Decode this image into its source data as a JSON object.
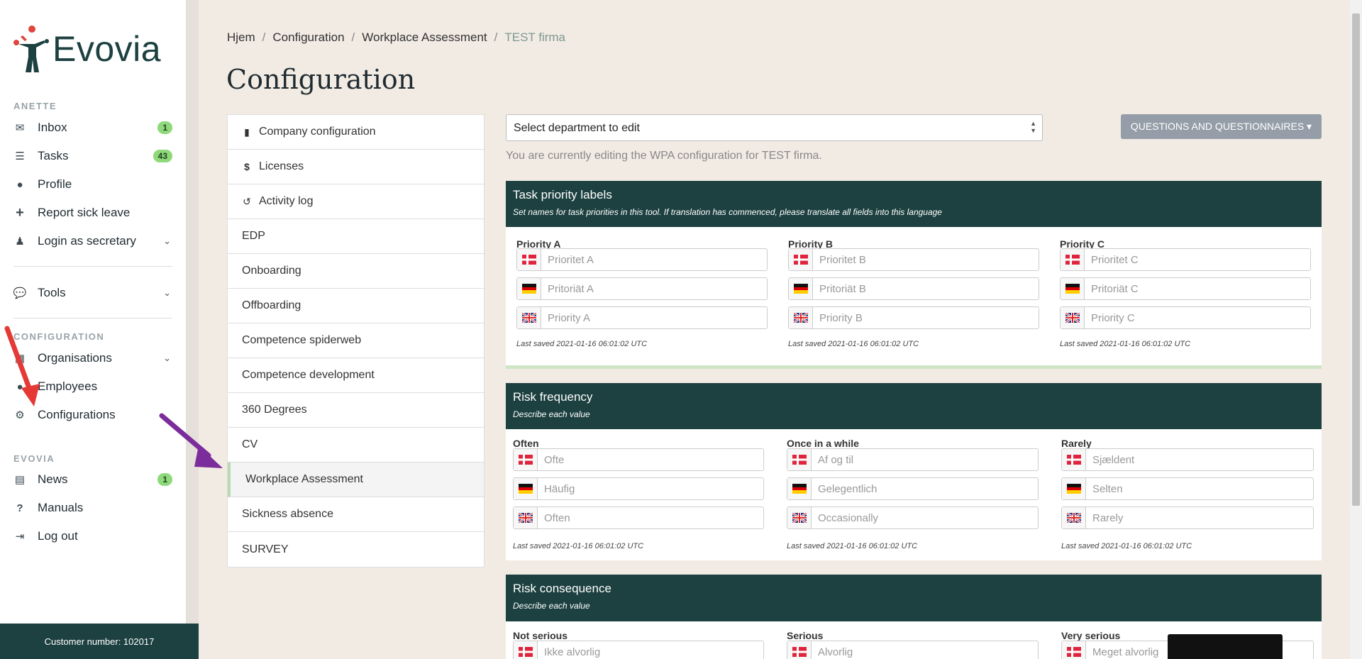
{
  "brand": {
    "name": "Evovia",
    "logo_color": "#1d4040",
    "accent_red": "#e0443c"
  },
  "sidebar": {
    "sections": [
      {
        "label": "ANETTE"
      },
      {
        "label": "CONFIGURATION"
      },
      {
        "label": "EVOVIA"
      }
    ],
    "items": [
      {
        "label": "Inbox",
        "icon": "envelope-icon",
        "badge": "1"
      },
      {
        "label": "Tasks",
        "icon": "tasks-icon",
        "badge": "43"
      },
      {
        "label": "Profile",
        "icon": "user-icon"
      },
      {
        "label": "Report sick leave",
        "icon": "plus-icon"
      },
      {
        "label": "Login as secretary",
        "icon": "secretary-icon"
      },
      {
        "label": "Tools",
        "icon": "chat-icon"
      },
      {
        "label": "Organisations",
        "icon": "building-icon"
      },
      {
        "label": "Employees",
        "icon": "users-icon"
      },
      {
        "label": "Configurations",
        "icon": "gear-icon"
      },
      {
        "label": "News",
        "icon": "newspaper-icon",
        "badge": "1"
      },
      {
        "label": "Manuals",
        "icon": "question-icon"
      },
      {
        "label": "Log out",
        "icon": "logout-icon"
      }
    ],
    "customer_number": "Customer number: 102017"
  },
  "breadcrumb": {
    "home": "Hjem",
    "level1": "Configuration",
    "level2": "Workplace Assessment",
    "current": "TEST firma",
    "sep": "/"
  },
  "page_title": "Configuration",
  "config_menu": [
    {
      "label": "Company configuration",
      "icon": "building-icon",
      "glyph": "▮"
    },
    {
      "label": "Licenses",
      "icon": "dollar-icon",
      "glyph": "$"
    },
    {
      "label": "Activity log",
      "icon": "history-icon",
      "glyph": "↺"
    },
    {
      "label": "EDP"
    },
    {
      "label": "Onboarding"
    },
    {
      "label": "Offboarding"
    },
    {
      "label": "Competence spiderweb"
    },
    {
      "label": "Competence development"
    },
    {
      "label": "360 Degrees"
    },
    {
      "label": "CV"
    },
    {
      "label": "Workplace Assessment",
      "active": true
    },
    {
      "label": "Sickness absence"
    },
    {
      "label": "SURVEY"
    }
  ],
  "department_select": {
    "value": "Select department to edit"
  },
  "questions_button": {
    "label": "QUESTIONS AND QUESTIONNAIRES ▾"
  },
  "editing_note": "You are currently editing the WPA configuration for TEST firma.",
  "panels": [
    {
      "title": "Task priority labels",
      "subtitle": "Set names for task priorities in this tool. If translation has commenced, please translate all fields into this language",
      "columns": [
        {
          "label": "Priority A",
          "fields": [
            "Prioritet A",
            "Pritoriät A",
            "Priority A"
          ],
          "saved": "Last saved 2021-01-16 06:01:02 UTC"
        },
        {
          "label": "Priority B",
          "fields": [
            "Prioritet B",
            "Pritoriät B",
            "Priority B"
          ],
          "saved": "Last saved 2021-01-16 06:01:02 UTC"
        },
        {
          "label": "Priority C",
          "fields": [
            "Prioritet C",
            "Pritoriät C",
            "Priority C"
          ],
          "saved": "Last saved 2021-01-16 06:01:02 UTC"
        }
      ]
    },
    {
      "title": "Risk frequency",
      "subtitle": "Describe each value",
      "columns": [
        {
          "label": "Often",
          "fields": [
            "Ofte",
            "Häufig",
            "Often"
          ],
          "saved": "Last saved 2021-01-16 06:01:02 UTC"
        },
        {
          "label": "Once in a while",
          "fields": [
            "Af og til",
            "Gelegentlich",
            "Occasionally"
          ],
          "saved": "Last saved 2021-01-16 06:01:02 UTC"
        },
        {
          "label": "Rarely",
          "fields": [
            "Sjældent",
            "Selten",
            "Rarely"
          ],
          "saved": "Last saved 2021-01-16 06:01:02 UTC"
        }
      ]
    },
    {
      "title": "Risk consequence",
      "subtitle": "Describe each value",
      "columns": [
        {
          "label": "Not serious",
          "fields": [
            "Ikke alvorlig"
          ]
        },
        {
          "label": "Serious",
          "fields": [
            "Alvorlig"
          ]
        },
        {
          "label": "Very serious",
          "fields": [
            "Meget alvorlig"
          ]
        }
      ]
    }
  ],
  "flags": [
    "danish-flag-icon",
    "german-flag-icon",
    "uk-flag-icon"
  ]
}
